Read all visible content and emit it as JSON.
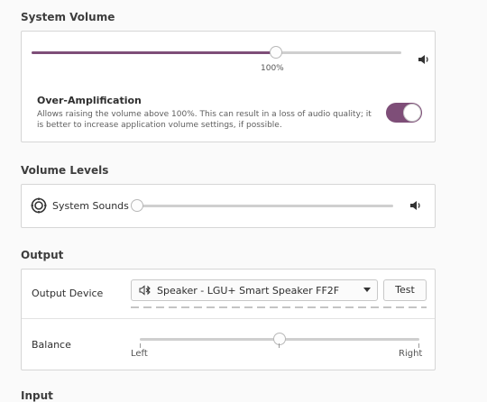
{
  "system_volume": {
    "title": "System Volume",
    "level_percent": 100,
    "slider_fill_fraction": 0.66,
    "value_label": "100%",
    "icon": "speaker-icon",
    "over_amplification": {
      "title": "Over-Amplification",
      "description": "Allows raising the volume above 100%. This can result in a loss of audio quality; it is better to increase application volume settings, if possible.",
      "enabled": true
    }
  },
  "volume_levels": {
    "title": "Volume Levels",
    "items": [
      {
        "label": "System Sounds",
        "icon": "system-sounds-icon",
        "level_fraction": 0.0
      }
    ]
  },
  "output": {
    "title": "Output",
    "device_label": "Output Device",
    "device_value": "Speaker - LGU+ Smart Speaker FF2F",
    "device_icon": "bluetooth-icon",
    "test_label": "Test",
    "balance_label": "Balance",
    "balance_fraction": 0.5,
    "balance_left": "Left",
    "balance_right": "Right"
  },
  "input": {
    "title": "Input"
  },
  "colors": {
    "accent": "#7e4e78"
  }
}
